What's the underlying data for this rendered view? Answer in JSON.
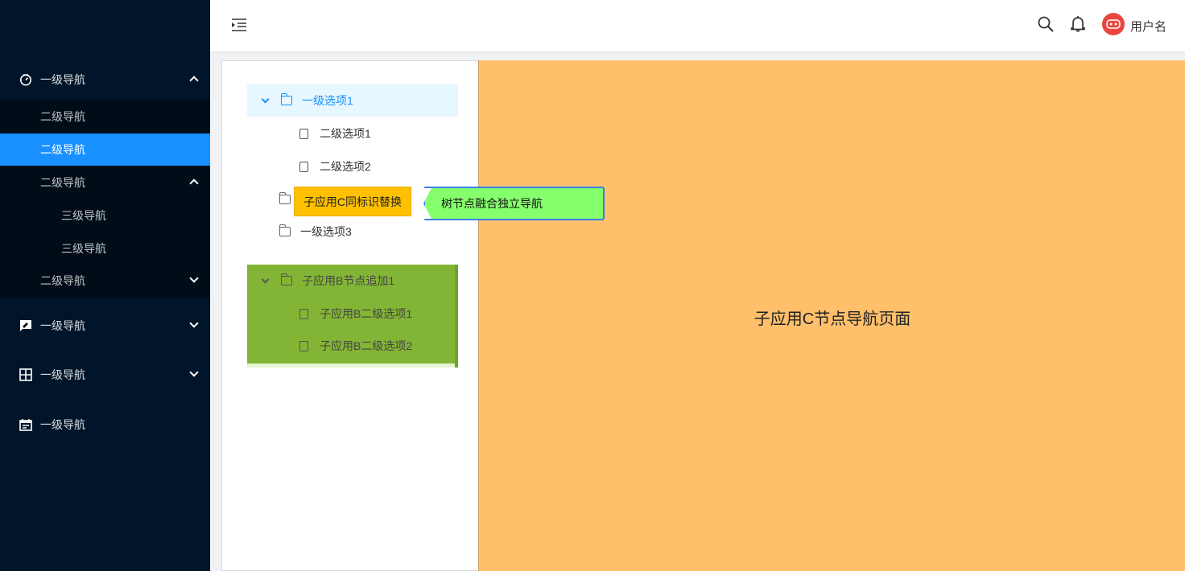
{
  "sidebar": {
    "nav1": {
      "label": "一级导航",
      "icon": "dashboard-icon",
      "expanded": true
    },
    "nav1_children": [
      {
        "label": "二级导航",
        "active": false
      },
      {
        "label": "二级导航",
        "active": true
      },
      {
        "label": "二级导航",
        "expanded": true,
        "children": [
          {
            "label": "三级导航"
          },
          {
            "label": "三级导航"
          }
        ]
      },
      {
        "label": "二级导航",
        "expanded": false
      }
    ],
    "nav2": {
      "label": "一级导航",
      "icon": "feedback-icon"
    },
    "nav3": {
      "label": "一级导航",
      "icon": "grid-icon"
    },
    "nav4": {
      "label": "一级导航",
      "icon": "calendar-icon"
    },
    "colors": {
      "bg": "#001529",
      "active": "#1890ff"
    }
  },
  "header": {
    "username": "用户名",
    "icons": [
      "menu-fold-icon",
      "search-icon",
      "bell-icon",
      "avatar"
    ]
  },
  "tree": {
    "node1": {
      "label": "一级选项1",
      "selected": true,
      "expanded": true
    },
    "node1_children": [
      {
        "label": "二级选项1"
      },
      {
        "label": "二级选项2"
      }
    ],
    "node2_tag": "子应用C同标识替换",
    "node3": {
      "label": "一级选项3"
    },
    "nodeB": {
      "label": "子应用B节点追加1",
      "expanded": true
    },
    "nodeB_children": [
      {
        "label": "子应用B二级选项1"
      },
      {
        "label": "子应用B二级选项2"
      }
    ]
  },
  "tooltip": {
    "label": "树节点融合独立导航",
    "color": "#86ff6c"
  },
  "content": {
    "title": "子应用C节点导航页面",
    "bg": "#ffbf6b"
  }
}
